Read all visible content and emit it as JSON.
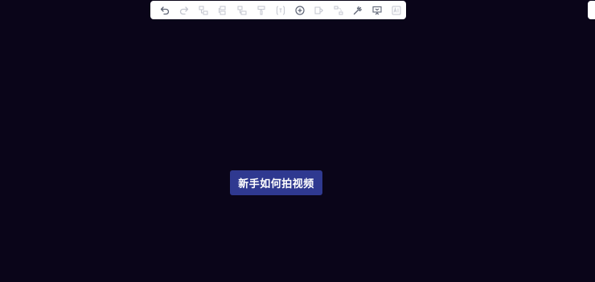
{
  "toolbar": {
    "buttons": [
      {
        "icon": "undo-icon",
        "enabled": true
      },
      {
        "icon": "redo-icon",
        "enabled": false
      },
      {
        "icon": "insert-child-node-icon",
        "enabled": false
      },
      {
        "icon": "insert-sibling-node-icon",
        "enabled": false
      },
      {
        "icon": "insert-parent-node-icon",
        "enabled": false
      },
      {
        "icon": "format-painter-icon",
        "enabled": false
      },
      {
        "icon": "formula-icon",
        "enabled": false
      },
      {
        "icon": "add-icon",
        "enabled": true
      },
      {
        "icon": "summary-icon",
        "enabled": false
      },
      {
        "icon": "relation-line-icon",
        "enabled": false
      },
      {
        "icon": "magic-wand-icon",
        "enabled": true
      },
      {
        "icon": "presentation-icon",
        "enabled": true
      },
      {
        "icon": "ai-icon",
        "enabled": false
      }
    ]
  },
  "mindmap": {
    "root_topic": "新手如何拍视频"
  },
  "colors": {
    "canvas_background": "#0a0519",
    "root_topic_fill": "#2f3990",
    "root_topic_text": "#ffffff",
    "toolbar_background": "#ffffff"
  }
}
